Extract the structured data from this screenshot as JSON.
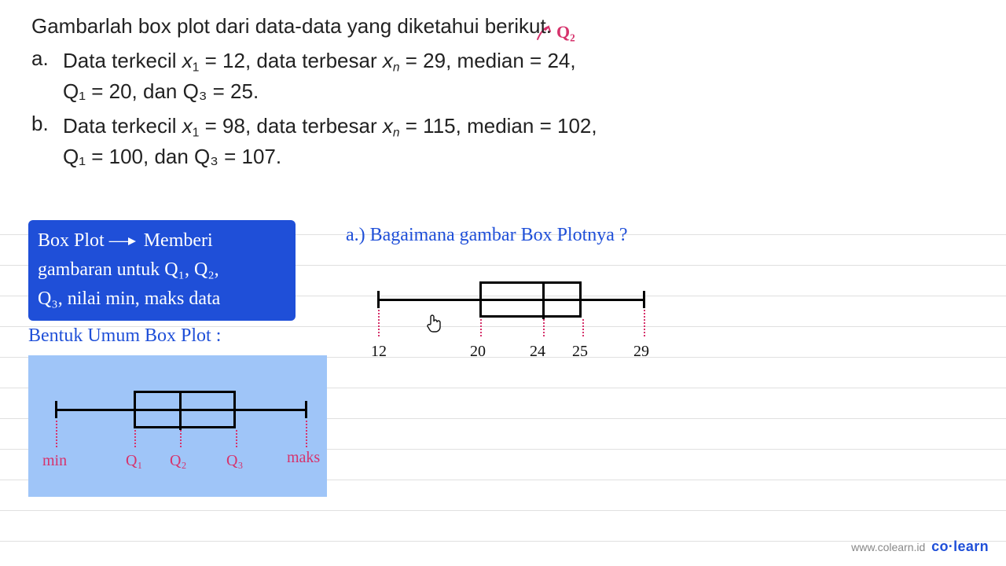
{
  "problem": {
    "title": "Gambarlah box plot dari data-data yang diketahui berikut.",
    "items": [
      {
        "label": "a.",
        "line1_pre": "Data terkecil ",
        "x1": "x",
        "x1_sub": "1",
        "x1_eq": " = 12, data terbesar ",
        "xn": "x",
        "xn_sub": "n",
        "xn_eq": " = 29, median = 24,",
        "line2": "Q₁ = 20, dan Q₃ = 25."
      },
      {
        "label": "b.",
        "line1_pre": "Data terkecil ",
        "x1": "x",
        "x1_sub": "1",
        "x1_eq": " = 98, data terbesar ",
        "xn": "x",
        "xn_sub": "n",
        "xn_eq": " = 115, median = 102,",
        "line2": "Q₁ = 100, dan Q₃ = 107."
      }
    ],
    "q2_annotation": "Q₂"
  },
  "blue_box": {
    "line1a": "Box Plot",
    "line1b": "Memberi",
    "line2": "gambaran untuk Q₁, Q₂,",
    "line3": "Q₃, nilai min, maks data"
  },
  "umum_title": "Bentuk Umum Box Plot :",
  "question_a": "a.) Bagaimana gambar Box Plotnya ?",
  "generic_boxplot": {
    "labels": {
      "min": "min",
      "q1": "Q₁",
      "q2": "Q₂",
      "q3": "Q₃",
      "max": "maks"
    }
  },
  "chart_data": {
    "type": "boxplot",
    "title": "Box Plot (a)",
    "min": 12,
    "q1": 20,
    "median": 24,
    "q3": 25,
    "max": 29,
    "axis_values": [
      12,
      20,
      24,
      25,
      29
    ]
  },
  "boxplot_a_labels": {
    "v0": "12",
    "v1": "20",
    "v2": "24",
    "v3": "25",
    "v4": "29"
  },
  "watermark": {
    "url": "www.colearn.id",
    "brand_pre": "co·",
    "brand_bold": "learn"
  }
}
